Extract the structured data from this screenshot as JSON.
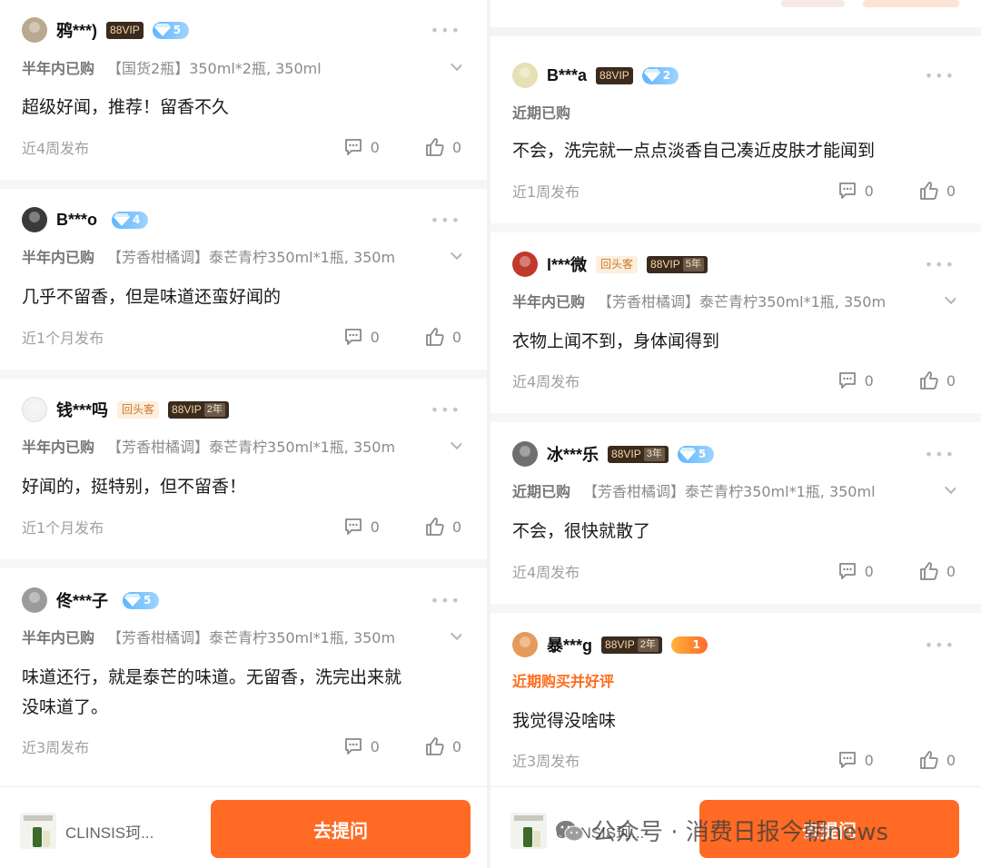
{
  "left": {
    "reviews": [
      {
        "user": "鸦***)",
        "vip": "88VIP",
        "years": "",
        "diamond": "5",
        "returning": "",
        "crown": "",
        "avatar_color": "#b8a98f",
        "purchase_when": "半年内已购",
        "sku": "【国货2瓶】350ml*2瓶, 350ml",
        "text": [
          "超级好闻，推荐！留香不久"
        ],
        "posted": "近4周发布",
        "comments": "0",
        "likes": "0"
      },
      {
        "user": "B***o",
        "vip": "",
        "years": "",
        "diamond": "4",
        "returning": "",
        "crown": "",
        "avatar_color": "#3a3a3a",
        "purchase_when": "半年内已购",
        "sku": "【芳香柑橘调】泰芒青柠350ml*1瓶, 350m",
        "text": [
          "几乎不留香，但是味道还蛮好闻的"
        ],
        "posted": "近1个月发布",
        "comments": "0",
        "likes": "0"
      },
      {
        "user": "钱***吗",
        "vip": "88VIP",
        "years": "2年",
        "diamond": "",
        "returning": "回头客",
        "crown": "",
        "avatar_color": "#f2f2f2",
        "purchase_when": "半年内已购",
        "sku": "【芳香柑橘调】泰芒青柠350ml*1瓶, 350m",
        "text": [
          "好闻的，挺特别，但不留香！"
        ],
        "posted": "近1个月发布",
        "comments": "0",
        "likes": "0"
      },
      {
        "user": "佟***子",
        "vip": "",
        "years": "",
        "diamond": "5",
        "returning": "",
        "crown": "",
        "avatar_color": "#9b9b9b",
        "purchase_when": "半年内已购",
        "sku": "【芳香柑橘调】泰芒青柠350ml*1瓶, 350m",
        "text": [
          "味道还行，就是泰芒的味道。无留香，洗完出来就",
          "没味道了。"
        ],
        "posted": "近3周发布",
        "comments": "0",
        "likes": "0"
      }
    ],
    "product_name": "CLINSIS珂...",
    "ask_label": "去提问"
  },
  "right": {
    "reviews": [
      {
        "user": "B***a",
        "vip": "88VIP",
        "years": "",
        "diamond": "2",
        "returning": "",
        "crown": "",
        "avatar_color": "#e6e0b4",
        "purchase_when": "近期已购",
        "sku": "",
        "hot": false,
        "text": [
          "不会，洗完就一点点淡香自己凑近皮肤才能闻到"
        ],
        "posted": "近1周发布",
        "comments": "0",
        "likes": "0"
      },
      {
        "user": "l***微",
        "vip": "88VIP",
        "years": "5年",
        "diamond": "",
        "returning": "回头客",
        "crown": "",
        "avatar_color": "#c0392b",
        "purchase_when": "半年内已购",
        "sku": "【芳香柑橘调】泰芒青柠350ml*1瓶, 350m",
        "hot": false,
        "text": [
          "衣物上闻不到，身体闻得到"
        ],
        "posted": "近4周发布",
        "comments": "0",
        "likes": "0"
      },
      {
        "user": "冰***乐",
        "vip": "88VIP",
        "years": "3年",
        "diamond": "5",
        "returning": "",
        "crown": "",
        "avatar_color": "#6f6f6f",
        "purchase_when": "近期已购",
        "sku": "【芳香柑橘调】泰芒青柠350ml*1瓶, 350ml",
        "hot": false,
        "text": [
          "不会，很快就散了"
        ],
        "posted": "近4周发布",
        "comments": "0",
        "likes": "0"
      },
      {
        "user": "暴***g",
        "vip": "88VIP",
        "years": "2年",
        "diamond": "",
        "returning": "",
        "crown": "1",
        "avatar_color": "#e49a5a",
        "purchase_when": "近期购买并好评",
        "sku": "",
        "hot": true,
        "text": [
          "我觉得没啥味"
        ],
        "posted": "近3周发布",
        "comments": "0",
        "likes": "0"
      }
    ],
    "product_name": "CLINSIS珂...",
    "ask_label": "去提问"
  },
  "watermark": {
    "text": "公众号 · 消费日报今朝news"
  },
  "colors": {
    "accent": "#ff6a24",
    "vip_bg": "#3b2a1e",
    "diamond": "#5fb6ff",
    "hot": "#ff6a1a"
  }
}
